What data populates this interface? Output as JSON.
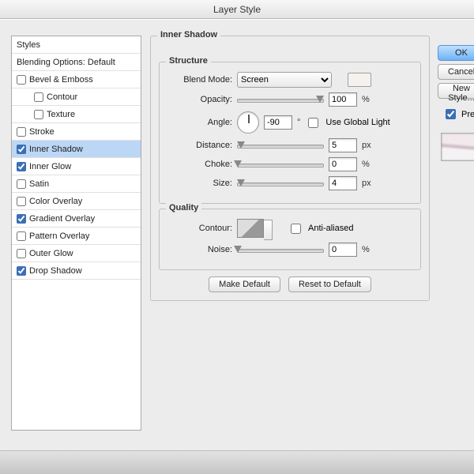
{
  "window": {
    "title": "Layer Style"
  },
  "left": {
    "header1": "Styles",
    "header2": "Blending Options: Default",
    "items": [
      {
        "label": "Bevel & Emboss",
        "checked": false,
        "sub": false
      },
      {
        "label": "Contour",
        "checked": false,
        "sub": true
      },
      {
        "label": "Texture",
        "checked": false,
        "sub": true
      },
      {
        "label": "Stroke",
        "checked": false,
        "sub": false
      },
      {
        "label": "Inner Shadow",
        "checked": true,
        "sub": false,
        "selected": true
      },
      {
        "label": "Inner Glow",
        "checked": true,
        "sub": false
      },
      {
        "label": "Satin",
        "checked": false,
        "sub": false
      },
      {
        "label": "Color Overlay",
        "checked": false,
        "sub": false
      },
      {
        "label": "Gradient Overlay",
        "checked": true,
        "sub": false
      },
      {
        "label": "Pattern Overlay",
        "checked": false,
        "sub": false
      },
      {
        "label": "Outer Glow",
        "checked": false,
        "sub": false
      },
      {
        "label": "Drop Shadow",
        "checked": true,
        "sub": false
      }
    ]
  },
  "main": {
    "title": "Inner Shadow",
    "structure": {
      "legend": "Structure",
      "blend_mode_label": "Blend Mode:",
      "blend_mode_value": "Screen",
      "color": "#f6f1ec",
      "opacity_label": "Opacity:",
      "opacity_value": "100",
      "opacity_unit": "%",
      "angle_label": "Angle:",
      "angle_value": "-90",
      "angle_unit": "°",
      "use_global_label": "Use Global Light",
      "use_global_checked": false,
      "distance_label": "Distance:",
      "distance_value": "5",
      "distance_unit": "px",
      "choke_label": "Choke:",
      "choke_value": "0",
      "choke_unit": "%",
      "size_label": "Size:",
      "size_value": "4",
      "size_unit": "px"
    },
    "quality": {
      "legend": "Quality",
      "contour_label": "Contour:",
      "anti_label": "Anti-aliased",
      "anti_checked": false,
      "noise_label": "Noise:",
      "noise_value": "0",
      "noise_unit": "%"
    },
    "btn_make_default": "Make Default",
    "btn_reset_default": "Reset to Default"
  },
  "right": {
    "ok": "OK",
    "cancel": "Cancel",
    "newstyle": "New Style...",
    "preview_label": "Preview",
    "preview_checked": true
  }
}
